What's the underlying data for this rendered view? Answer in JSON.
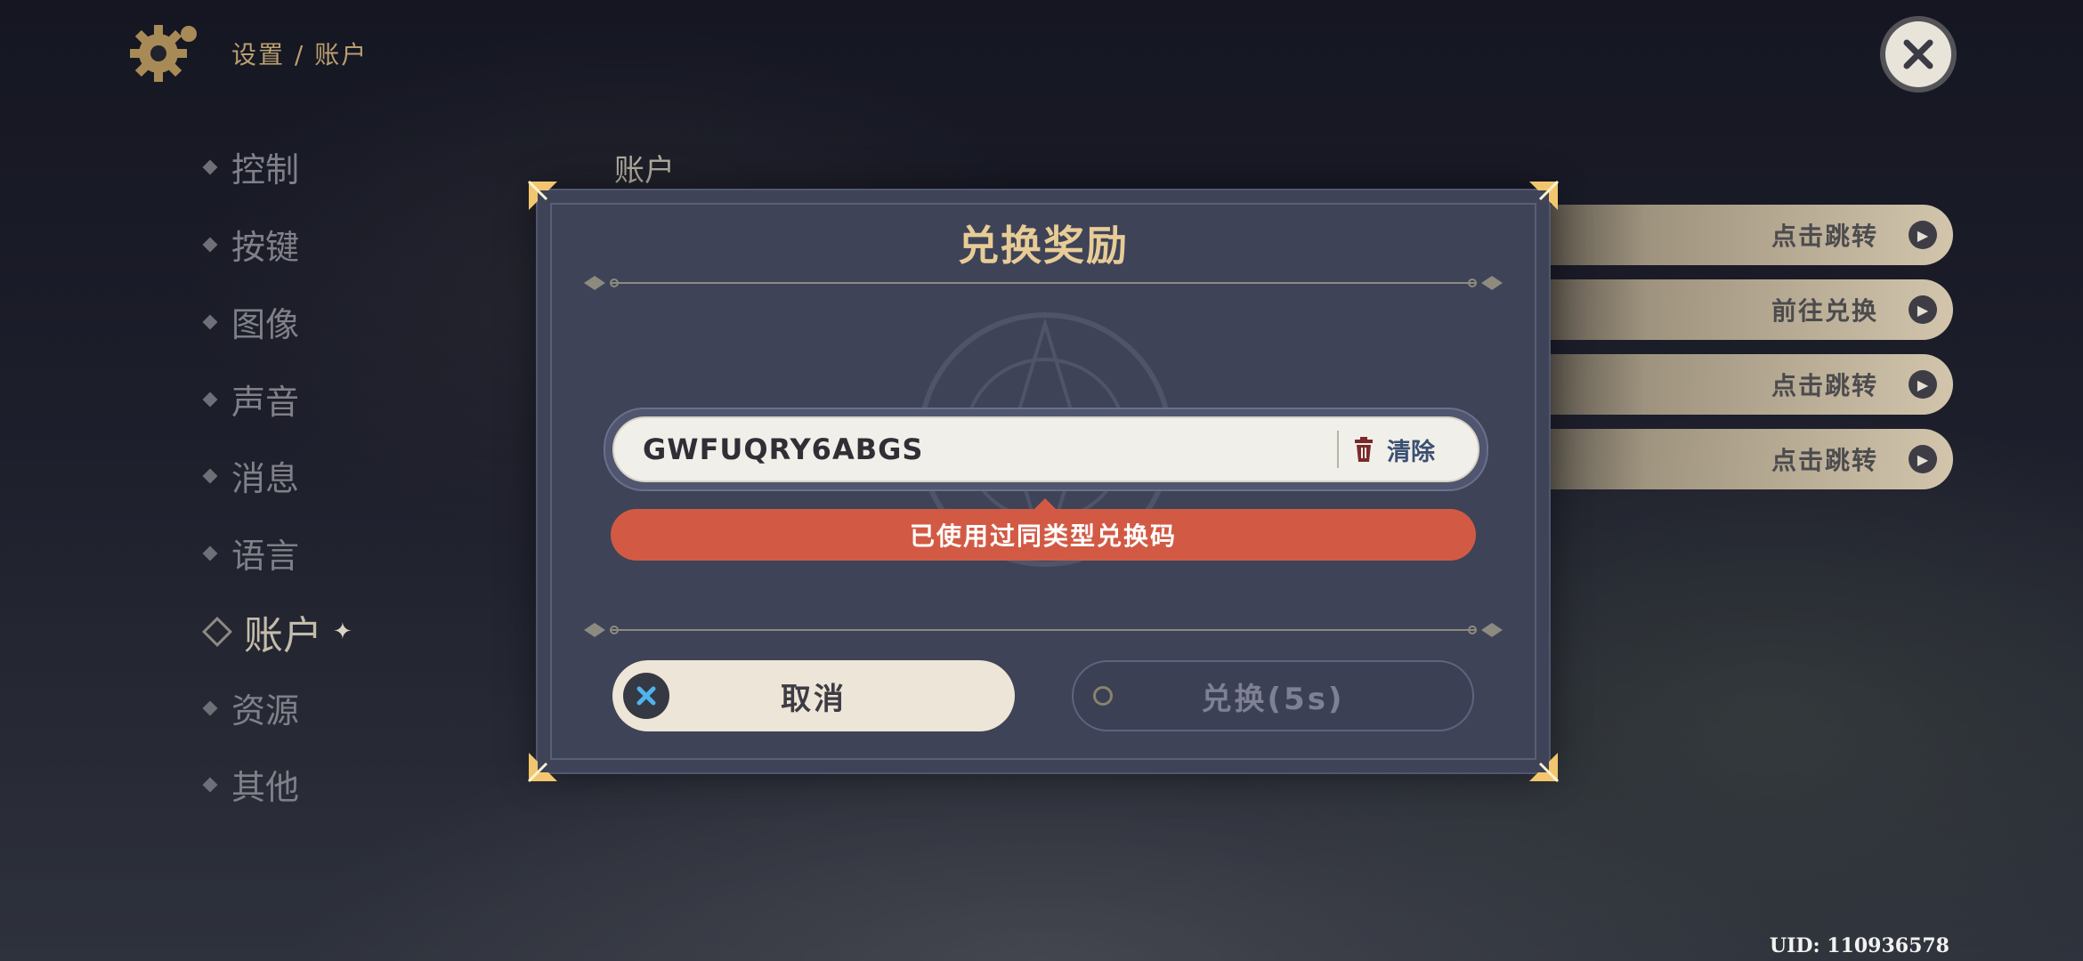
{
  "header": {
    "breadcrumb": "设置 / 账户",
    "settings_icon": "gear-icon",
    "close_icon": "close-icon"
  },
  "sidebar": {
    "items": [
      {
        "label": "控制",
        "active": false
      },
      {
        "label": "按键",
        "active": false
      },
      {
        "label": "图像",
        "active": false
      },
      {
        "label": "声音",
        "active": false
      },
      {
        "label": "消息",
        "active": false
      },
      {
        "label": "语言",
        "active": false
      },
      {
        "label": "账户",
        "active": true
      },
      {
        "label": "资源",
        "active": false
      },
      {
        "label": "其他",
        "active": false
      }
    ]
  },
  "content": {
    "title": "账户",
    "links": [
      {
        "label": "点击跳转"
      },
      {
        "label": "前往兑换"
      },
      {
        "label": "点击跳转"
      },
      {
        "label": "点击跳转"
      }
    ]
  },
  "dialog": {
    "title": "兑换奖励",
    "code_value": "GWFUQRY6ABGS",
    "clear_label": "清除",
    "error_message": "已使用过同类型兑换码",
    "cancel_label": "取消",
    "redeem_label": "兑换(5s)"
  },
  "footer": {
    "uid": "UID: 110936578"
  },
  "colors": {
    "accent_gold": "#e8cc96",
    "error_red": "#d25a44",
    "dialog_bg": "#3e4358"
  }
}
